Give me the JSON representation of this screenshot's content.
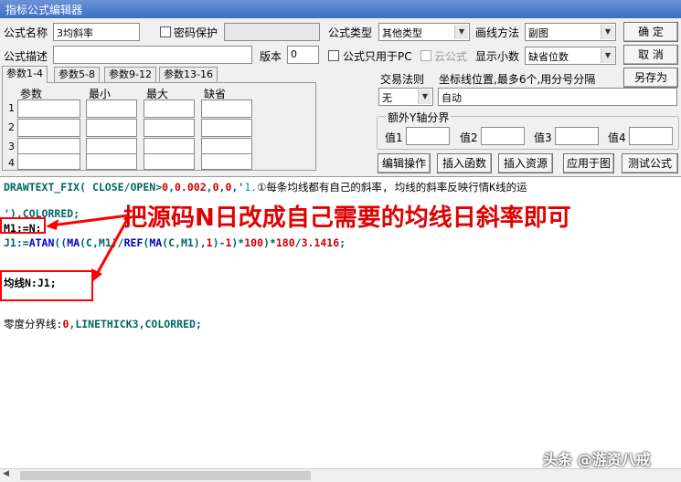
{
  "window": {
    "title": "指标公式编辑器"
  },
  "form": {
    "name_label": "公式名称",
    "name_value": "3均斜率",
    "password_label": "密码保护",
    "type_label": "公式类型",
    "type_value": "其他类型",
    "draw_label": "画线方法",
    "draw_value": "副图",
    "desc_label": "公式描述",
    "desc_value": "",
    "version_label": "版本",
    "version_value": "0",
    "pc_only_label": "公式只用于PC",
    "cloud_label": "云公式",
    "decimals_label": "显示小数",
    "decimals_value": "缺省位数"
  },
  "buttons": {
    "ok": "确  定",
    "cancel": "取  消",
    "save_as": "另存为",
    "edit_ops": "编辑操作",
    "insert_func": "插入函数",
    "insert_res": "插入资源",
    "apply_chart": "应用于图",
    "test": "测试公式"
  },
  "tabs": [
    "参数1-4",
    "参数5-8",
    "参数9-12",
    "参数13-16"
  ],
  "params": {
    "headers": [
      "参数",
      "最小",
      "最大",
      "缺省"
    ],
    "rows": [
      "1",
      "2",
      "3",
      "4"
    ]
  },
  "trade": {
    "rule_label": "交易法则",
    "rule_value": "无",
    "coord_label": "坐标线位置,最多6个,用分号分隔",
    "coord_value": "自动"
  },
  "yaxis": {
    "title": "额外Y轴分界",
    "labels": [
      "值1",
      "值2",
      "值3",
      "值4"
    ]
  },
  "code": {
    "line1": {
      "a": "DRAWTEXT_FIX(",
      "b": " CLOSE/OPEN",
      "c": ">",
      "d": "0",
      "e": ",",
      "f": "0.002",
      "g": ",",
      "h": "0",
      "i": ",",
      "j": "0",
      "k": ",'",
      "l": "1.",
      "m": "①每条均线都有自己的斜率, 均线的斜率反映行情K线的运"
    },
    "line2": {
      "a": "'),",
      "b": "COLORRED",
      "c": ";"
    },
    "line3": "M1:=N;",
    "line4": {
      "a": "J1:=",
      "b": "ATAN",
      "c": "((",
      "d": "MA",
      "e": "(C,M1)/",
      "f": "REF",
      "g": "(",
      "h": "MA",
      "i": "(C,M1),",
      "j": "1",
      "k": ")-",
      "l": "1",
      "m": ")*",
      "n": "100",
      "o": ")*",
      "p": "180",
      "q": "/",
      "r": "3.1416",
      "s": ";"
    },
    "line5": "均线N:J1;",
    "line6": {
      "a": "零度分界线:",
      "b": "0",
      "c": ",",
      "d": "LINETHICK3",
      "e": ",",
      "f": "COLORRED",
      "g": ";"
    }
  },
  "annotation": {
    "text": "把源码N日改成自己需要的均线日斜率即可",
    "color": "#e00000"
  },
  "watermark": "头条 @游资八戒"
}
